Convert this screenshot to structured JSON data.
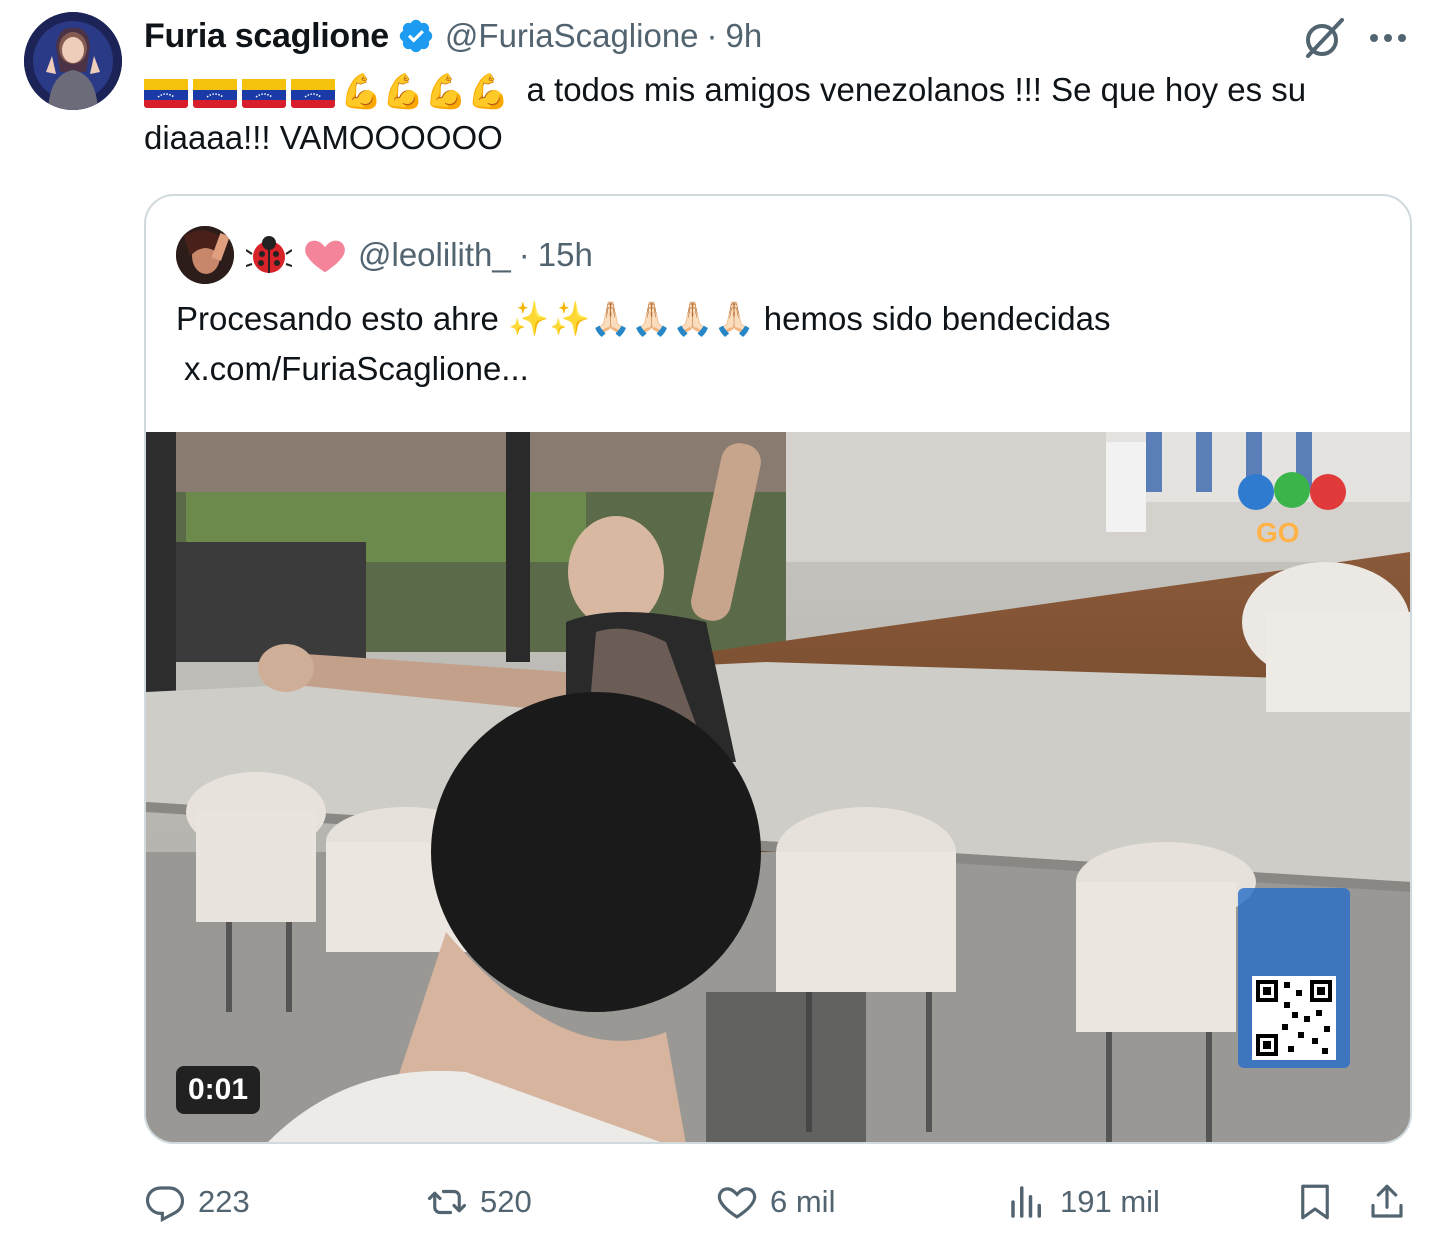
{
  "tweet": {
    "author_name": "Furia scaglione",
    "handle": "@FuriaScaglione",
    "separator": "·",
    "time": "9h",
    "text_main": "a todos mis amigos venezolanos !!! Se que hoy es su diaaaa!!! VAMOOOOOO",
    "emoji_flex": "💪💪💪💪"
  },
  "quote": {
    "emoji_1": "🐞",
    "emoji_2": "♥",
    "handle": "@leolilith_",
    "separator": "·",
    "time": "15h",
    "text_before": "Procesando esto ahre",
    "emoji_sparkles": "✨✨",
    "emoji_pray": "🙏🏻🙏🏻🙏🏻🙏🏻",
    "text_after": "hemos sido bendecidas",
    "link": "x.com/FuriaScaglione..."
  },
  "video": {
    "duration": "0:01"
  },
  "actions": {
    "replies": "223",
    "retweets": "520",
    "likes": "6 mil",
    "views": "191 mil"
  },
  "colors": {
    "text": "#0f1419",
    "muted": "#536471",
    "verified": "#1d9bf0",
    "border": "#cfd9de",
    "heart_emoji": "#f4849a"
  },
  "icons": [
    "verified-badge-icon",
    "grok-icon",
    "more-icon",
    "reply-icon",
    "retweet-icon",
    "like-icon",
    "views-icon",
    "bookmark-icon",
    "share-icon"
  ]
}
